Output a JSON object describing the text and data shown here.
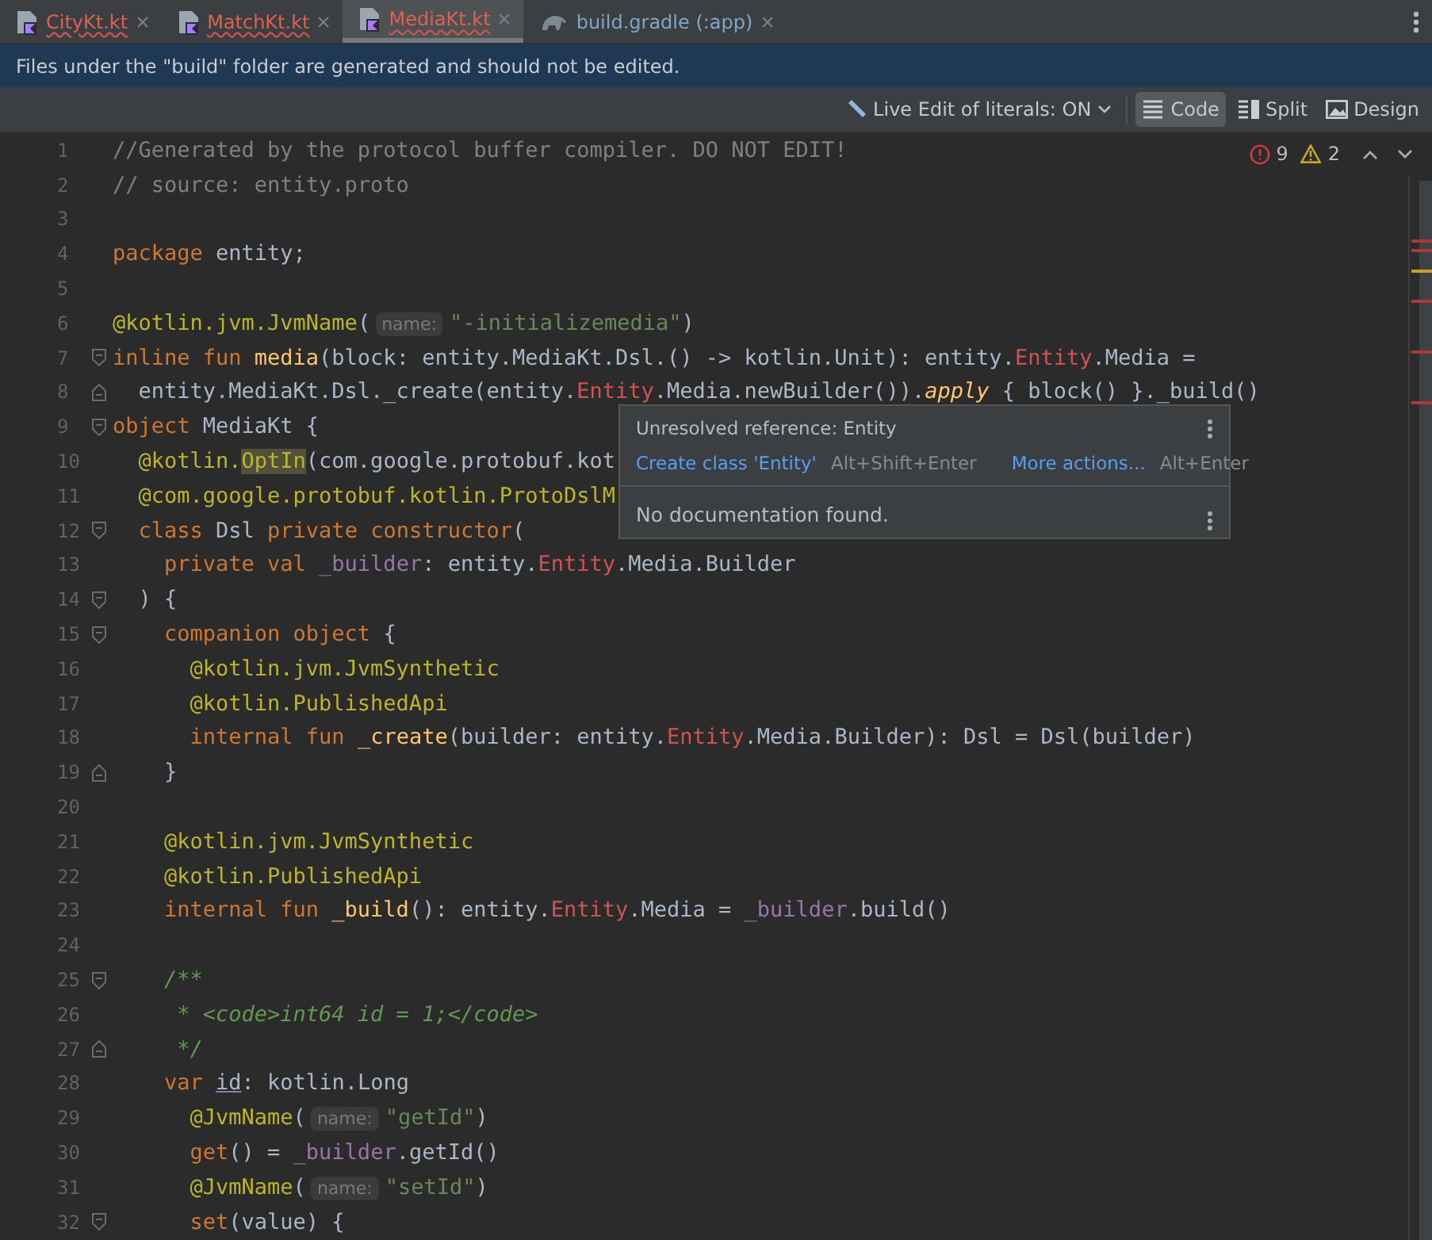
{
  "tabs": [
    {
      "label": "CityKt.kt",
      "kind": "kotlin",
      "error": true,
      "selected": false
    },
    {
      "label": "MatchKt.kt",
      "kind": "kotlin",
      "error": true,
      "selected": false
    },
    {
      "label": "MediaKt.kt",
      "kind": "kotlin",
      "error": true,
      "selected": true
    },
    {
      "label": "build.gradle (:app)",
      "kind": "gradle",
      "error": false,
      "selected": false
    }
  ],
  "banner": "Files under the \"build\" folder are generated and should not be edited.",
  "toolbar": {
    "live_edit": "Live Edit of literals: ON",
    "modes": [
      {
        "label": "Code",
        "kind": "code",
        "selected": true
      },
      {
        "label": "Split",
        "kind": "split",
        "selected": false
      },
      {
        "label": "Design",
        "kind": "design",
        "selected": false
      }
    ]
  },
  "inspections": {
    "errors": "9",
    "warnings": "2"
  },
  "lines": [
    {
      "number": "1",
      "tokens": [
        {
          "kind": "comment",
          "text": "//Generated by the protocol buffer compiler. DO NOT EDIT!"
        }
      ]
    },
    {
      "number": "2",
      "tokens": [
        {
          "kind": "comment",
          "text": "// source: entity.proto"
        }
      ]
    },
    {
      "number": "3"
    },
    {
      "number": "4",
      "tokens": [
        {
          "kind": "keyword",
          "text": "package "
        },
        {
          "kind": "plain",
          "text": "entity;"
        }
      ]
    },
    {
      "number": "5"
    },
    {
      "number": "6",
      "tokens": [
        {
          "kind": "annotation",
          "text": "@kotlin.jvm.JvmName"
        },
        {
          "kind": "plain",
          "text": "("
        },
        {
          "kind": "hint",
          "text": "name:"
        },
        {
          "kind": "string",
          "text": "\"-initializemedia\""
        },
        {
          "kind": "plain",
          "text": ")"
        }
      ]
    },
    {
      "number": "7",
      "fold_start": true,
      "tokens": [
        {
          "kind": "keyword",
          "text": "inline fun "
        },
        {
          "kind": "function",
          "text": "media"
        },
        {
          "kind": "plain",
          "text": "(block: entity.MediaKt.Dsl.() -> kotlin.Unit): entity."
        },
        {
          "kind": "error",
          "text": "Entity"
        },
        {
          "kind": "plain",
          "text": ".Media ="
        }
      ]
    },
    {
      "number": "8",
      "fold_end": true,
      "tokens": [
        {
          "kind": "plain",
          "text": "  entity.MediaKt.Dsl._create(entity."
        },
        {
          "kind": "error",
          "text": "Entity"
        },
        {
          "kind": "plain",
          "text": ".Media.newBuilder())."
        },
        {
          "kind": "italic",
          "text": "apply"
        },
        {
          "kind": "plain",
          "text": " { block() }._build()"
        }
      ]
    },
    {
      "number": "9",
      "fold_start": true,
      "tokens": [
        {
          "kind": "keyword",
          "text": "object "
        },
        {
          "kind": "plain",
          "text": "MediaKt {"
        }
      ]
    },
    {
      "number": "10",
      "tokens": [
        {
          "kind": "annotation",
          "text": "  @kotlin."
        },
        {
          "kind": "highlight",
          "text": "OptIn"
        },
        {
          "kind": "plain",
          "text": "(com.google.protobuf.kot"
        }
      ]
    },
    {
      "number": "11",
      "tokens": [
        {
          "kind": "annotation",
          "text": "  @com.google.protobuf.kotlin.ProtoDslM"
        }
      ]
    },
    {
      "number": "12",
      "fold_start": true,
      "tokens": [
        {
          "kind": "keyword",
          "text": "  class "
        },
        {
          "kind": "plain",
          "text": "Dsl "
        },
        {
          "kind": "keyword",
          "text": "private constructor"
        },
        {
          "kind": "plain",
          "text": "("
        }
      ]
    },
    {
      "number": "13",
      "tokens": [
        {
          "kind": "keyword",
          "text": "    private val "
        },
        {
          "kind": "property",
          "text": "_builder"
        },
        {
          "kind": "plain",
          "text": ": entity."
        },
        {
          "kind": "error",
          "text": "Entity"
        },
        {
          "kind": "plain",
          "text": ".Media.Builder"
        }
      ]
    },
    {
      "number": "14",
      "fold_start": true,
      "tokens": [
        {
          "kind": "plain",
          "text": "  ) {"
        }
      ]
    },
    {
      "number": "15",
      "fold_start": true,
      "tokens": [
        {
          "kind": "keyword",
          "text": "    companion object "
        },
        {
          "kind": "plain",
          "text": "{"
        }
      ]
    },
    {
      "number": "16",
      "tokens": [
        {
          "kind": "annotation",
          "text": "      @kotlin.jvm.JvmSynthetic"
        }
      ]
    },
    {
      "number": "17",
      "tokens": [
        {
          "kind": "annotation",
          "text": "      @kotlin.PublishedApi"
        }
      ]
    },
    {
      "number": "18",
      "tokens": [
        {
          "kind": "keyword",
          "text": "      internal fun "
        },
        {
          "kind": "function",
          "text": "_create"
        },
        {
          "kind": "plain",
          "text": "(builder: entity."
        },
        {
          "kind": "error",
          "text": "Entity"
        },
        {
          "kind": "plain",
          "text": ".Media.Builder): Dsl = Dsl(builder)"
        }
      ]
    },
    {
      "number": "19",
      "fold_end": true,
      "tokens": [
        {
          "kind": "plain",
          "text": "    }"
        }
      ]
    },
    {
      "number": "20"
    },
    {
      "number": "21",
      "tokens": [
        {
          "kind": "annotation",
          "text": "    @kotlin.jvm.JvmSynthetic"
        }
      ]
    },
    {
      "number": "22",
      "tokens": [
        {
          "kind": "annotation",
          "text": "    @kotlin.PublishedApi"
        }
      ]
    },
    {
      "number": "23",
      "tokens": [
        {
          "kind": "keyword",
          "text": "    internal fun "
        },
        {
          "kind": "function",
          "text": "_build"
        },
        {
          "kind": "plain",
          "text": "(): entity."
        },
        {
          "kind": "error",
          "text": "Entity"
        },
        {
          "kind": "plain",
          "text": ".Media = "
        },
        {
          "kind": "property",
          "text": "_builder"
        },
        {
          "kind": "plain",
          "text": ".build()"
        }
      ]
    },
    {
      "number": "24"
    },
    {
      "number": "25",
      "fold_start": true,
      "tokens": [
        {
          "kind": "doc",
          "text": "    /**"
        }
      ]
    },
    {
      "number": "26",
      "tokens": [
        {
          "kind": "doc",
          "text": "     * <code>int64 id = 1;</code>"
        }
      ]
    },
    {
      "number": "27",
      "fold_end": true,
      "tokens": [
        {
          "kind": "doc",
          "text": "     */"
        }
      ]
    },
    {
      "number": "28",
      "tokens": [
        {
          "kind": "keyword",
          "text": "    var "
        },
        {
          "kind": "underlined",
          "text": "id"
        },
        {
          "kind": "plain",
          "text": ": kotlin.Long"
        }
      ]
    },
    {
      "number": "29",
      "tokens": [
        {
          "kind": "annotation",
          "text": "      @JvmName"
        },
        {
          "kind": "plain",
          "text": "("
        },
        {
          "kind": "hint",
          "text": "name:"
        },
        {
          "kind": "string",
          "text": "\"getId\""
        },
        {
          "kind": "plain",
          "text": ")"
        }
      ]
    },
    {
      "number": "30",
      "tokens": [
        {
          "kind": "keyword",
          "text": "      get"
        },
        {
          "kind": "plain",
          "text": "() = "
        },
        {
          "kind": "property",
          "text": "_builder"
        },
        {
          "kind": "plain",
          "text": ".getId()"
        }
      ]
    },
    {
      "number": "31",
      "tokens": [
        {
          "kind": "annotation",
          "text": "      @JvmName"
        },
        {
          "kind": "plain",
          "text": "("
        },
        {
          "kind": "hint",
          "text": "name:"
        },
        {
          "kind": "string",
          "text": "\"setId\""
        },
        {
          "kind": "plain",
          "text": ")"
        }
      ]
    },
    {
      "number": "32",
      "fold_start": true,
      "tokens": [
        {
          "kind": "keyword",
          "text": "      set"
        },
        {
          "kind": "plain",
          "text": "(value) {"
        }
      ]
    }
  ],
  "popup": {
    "message": "Unresolved reference: Entity",
    "action": "Create class 'Entity'",
    "action_shortcut": "Alt+Shift+Enter",
    "more": "More actions...",
    "more_shortcut": "Alt+Enter",
    "documentation": "No documentation found."
  }
}
